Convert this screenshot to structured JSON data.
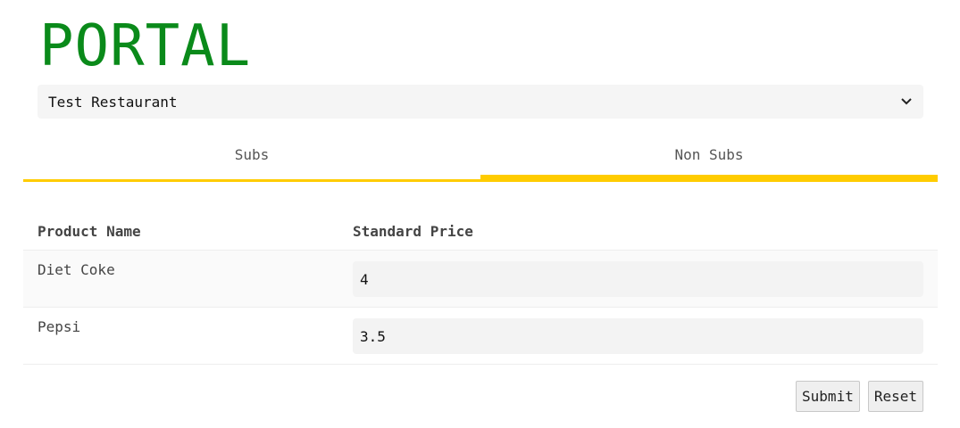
{
  "header": {
    "title": "PORTAL",
    "title_color": "#0a8a1a"
  },
  "restaurant_select": {
    "selected": "Test Restaurant",
    "icon": "chevron-down-icon"
  },
  "tabs": [
    {
      "label": "Subs",
      "active": false
    },
    {
      "label": "Non Subs",
      "active": true
    }
  ],
  "accent_color": "#ffcc00",
  "table": {
    "columns": [
      "Product Name",
      "Standard Price"
    ],
    "rows": [
      {
        "product": "Diet Coke",
        "price": "4"
      },
      {
        "product": "Pepsi",
        "price": "3.5"
      }
    ]
  },
  "actions": {
    "submit_label": "Submit",
    "reset_label": "Reset"
  }
}
